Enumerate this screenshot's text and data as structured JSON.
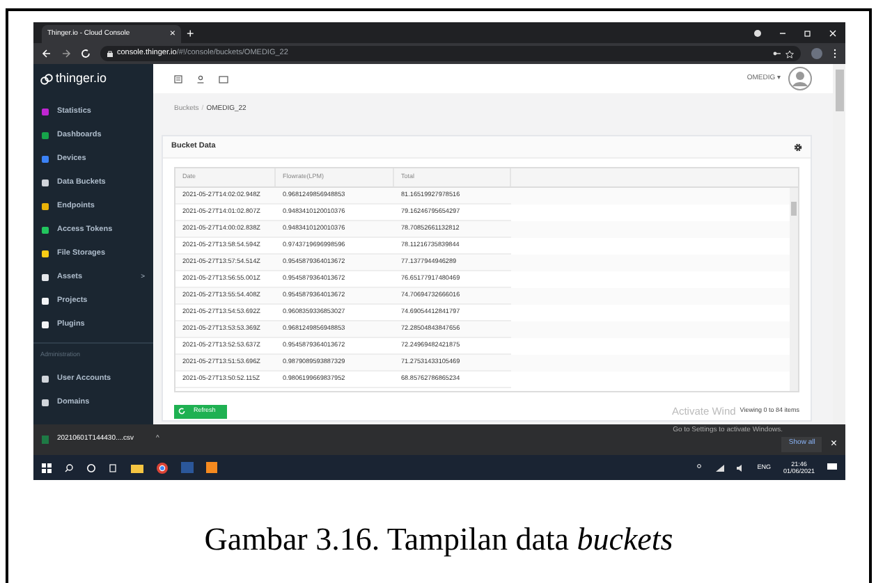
{
  "browser": {
    "tab_title": "Thinger.io - Cloud Console",
    "tab_close": "×",
    "new_tab": "+",
    "url_host": "console.thinger.io",
    "url_path": "/#!/console/buckets/OMEDIG_22"
  },
  "app": {
    "logo": "thinger.io",
    "user": "OMEDIG ▾"
  },
  "sidebar": {
    "items": [
      {
        "label": "Statistics",
        "color": "#c026d3"
      },
      {
        "label": "Dashboards",
        "color": "#16a34a"
      },
      {
        "label": "Devices",
        "color": "#3b82f6"
      },
      {
        "label": "Data Buckets",
        "color": "#d1d5db"
      },
      {
        "label": "Endpoints",
        "color": "#eab308"
      },
      {
        "label": "Access Tokens",
        "color": "#22c55e"
      },
      {
        "label": "File Storages",
        "color": "#facc15"
      },
      {
        "label": "Assets",
        "color": "#e5e7eb",
        "caret": ">"
      },
      {
        "label": "Projects",
        "color": "#f3f4f6"
      },
      {
        "label": "Plugins",
        "color": "#f3f4f6"
      }
    ],
    "section": "Administration",
    "admin_items": [
      {
        "label": "User Accounts",
        "color": "#d1d5db"
      },
      {
        "label": "Domains",
        "color": "#d1d5db"
      }
    ]
  },
  "breadcrumbs": [
    "Buckets",
    "OMEDIG_22"
  ],
  "breadcrumb_separator": "/",
  "card": {
    "title": "Bucket Data",
    "refresh": "Refresh",
    "footer": "Viewing 0 to 84 items"
  },
  "table": {
    "columns": [
      "Date",
      "Flowrate(LPM)",
      "Total"
    ],
    "rows": [
      [
        "2021-05-27T14:02:02.948Z",
        "0.9681249856948853",
        "81.16519927978516"
      ],
      [
        "2021-05-27T14:01:02.807Z",
        "0.9483410120010376",
        "79.16246795654297"
      ],
      [
        "2021-05-27T14:00:02.838Z",
        "0.9483410120010376",
        "78.70852661132812"
      ],
      [
        "2021-05-27T13:58:54.594Z",
        "0.9743719696998596",
        "78.11216735839844"
      ],
      [
        "2021-05-27T13:57:54.514Z",
        "0.9545879364013672",
        "77.1377944946289"
      ],
      [
        "2021-05-27T13:56:55.001Z",
        "0.9545879364013672",
        "76.65177917480469"
      ],
      [
        "2021-05-27T13:55:54.408Z",
        "0.9545879364013672",
        "74.70694732666016"
      ],
      [
        "2021-05-27T13:54:53.692Z",
        "0.9608359336853027",
        "74.69054412841797"
      ],
      [
        "2021-05-27T13:53:53.369Z",
        "0.9681249856948853",
        "72.28504843847656"
      ],
      [
        "2021-05-27T13:52:53.637Z",
        "0.9545879364013672",
        "72.24969482421875"
      ],
      [
        "2021-05-27T13:51:53.696Z",
        "0.9879089593887329",
        "71.27531433105469"
      ],
      [
        "2021-05-27T13:50:52.115Z",
        "0.9806199669837952",
        "68.85762786865234"
      ]
    ]
  },
  "activation": {
    "title": "Activate Wind",
    "subtitle": "Go to Settings to activate Windows."
  },
  "downloads": {
    "file": "20210601T144430....csv",
    "caret": "^",
    "show_all": "Show all",
    "close": "×"
  },
  "taskbar": {
    "language": "ENG",
    "time": "21:46",
    "date": "01/06/2021"
  },
  "caption": "Gambar 3.16. Tampilan data *buckets*"
}
